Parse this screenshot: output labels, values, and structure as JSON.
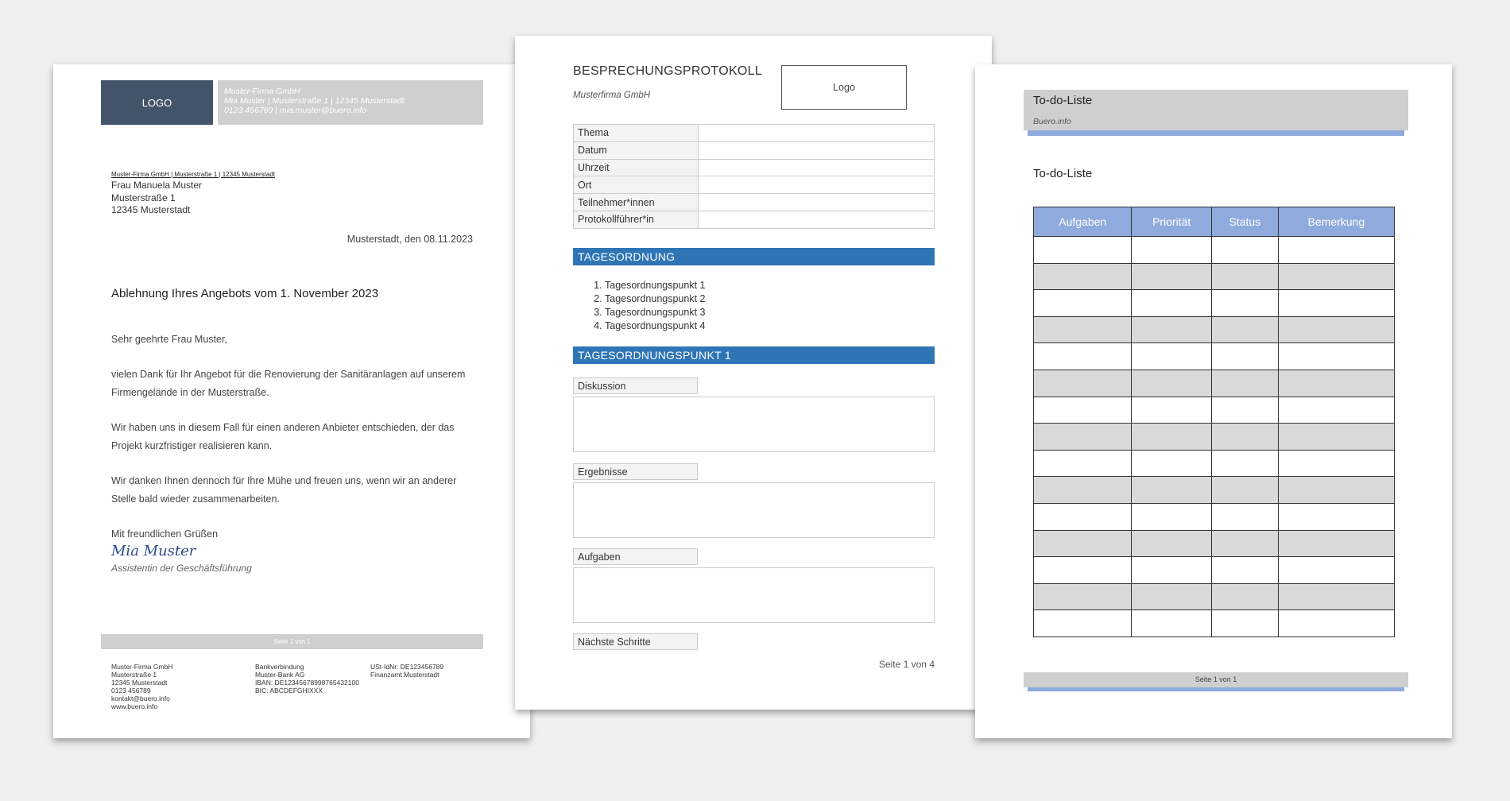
{
  "letter": {
    "logo": "LOGO",
    "company_header": [
      "Muster-Firma GmbH",
      "Mia Muster | Musterstraße 1 | 12345 Musterstadt",
      "0123 456789 | mia.muster@buero.info"
    ],
    "sender_line": "Muster-Firma GmbH | Musterstraße 1 | 12345 Musterstadt",
    "recipient": [
      "Frau Manuela Muster",
      "Musterstraße 1",
      "12345 Musterstadt"
    ],
    "date": "Musterstadt, den 08.11.2023",
    "subject": "Ablehnung Ihres Angebots vom 1. November 2023",
    "salutation": "Sehr geehrte Frau Muster,",
    "paragraphs": [
      "vielen Dank für Ihr Angebot für die Renovierung der Sanitäranlagen auf unserem Firmengelände in der Musterstraße.",
      "Wir haben uns in diesem Fall für einen anderen Anbieter entschieden, der das Projekt kurzfristiger realisieren kann.",
      "Wir danken Ihnen dennoch für Ihre Mühe und freuen uns, wenn wir an anderer Stelle bald wieder zusammenarbeiten."
    ],
    "closing": "Mit freundlichen Grüßen",
    "signature": "Mia Muster",
    "role": "Assistentin der Geschäftsführung",
    "footer_page": "Seite 1 von 1",
    "footer_col1": [
      "Muster-Firma GmbH",
      "Musterstraße 1",
      "12345 Musterstadt",
      "0123 456789",
      "kontakt@buero.info",
      "www.buero.info"
    ],
    "footer_col2": [
      "Bankverbindung",
      "Muster-Bank AG",
      "IBAN: DE12345678998765432100",
      "BIC: ABCDEFGHIXXX"
    ],
    "footer_col3": [
      "USt-IdNr: DE123456789",
      "Finanzamt Musterstadt"
    ]
  },
  "protocol": {
    "title": "BESPRECHUNGSPROTOKOLL",
    "subtitle": "Musterfirma GmbH",
    "logo": "Logo",
    "meta_fields": [
      "Thema",
      "Datum",
      "Uhrzeit",
      "Ort",
      "Teilnehmer*innen",
      "Protokollführer*in"
    ],
    "agenda_heading": "TAGESORDNUNG",
    "agenda_items": [
      "Tagesordnungspunkt 1",
      "Tagesordnungspunkt 2",
      "Tagesordnungspunkt 3",
      "Tagesordnungspunkt 4"
    ],
    "section_heading": "TAGESORDNUNGSPUNKT 1",
    "section_labels": [
      "Diskussion",
      "Ergebnisse",
      "Aufgaben",
      "Nächste Schritte"
    ],
    "page_number": "Seite 1 von 4",
    "accent_color": "#2e75b6"
  },
  "todo": {
    "header_title": "To-do-Liste",
    "header_sub": "Buero.info",
    "heading": "To-do-Liste",
    "columns": [
      "Aufgaben",
      "Priorität",
      "Status",
      "Bemerkung"
    ],
    "row_count": 15,
    "footer_page": "Seite 1 von 1",
    "accent_color": "#8faadc"
  }
}
